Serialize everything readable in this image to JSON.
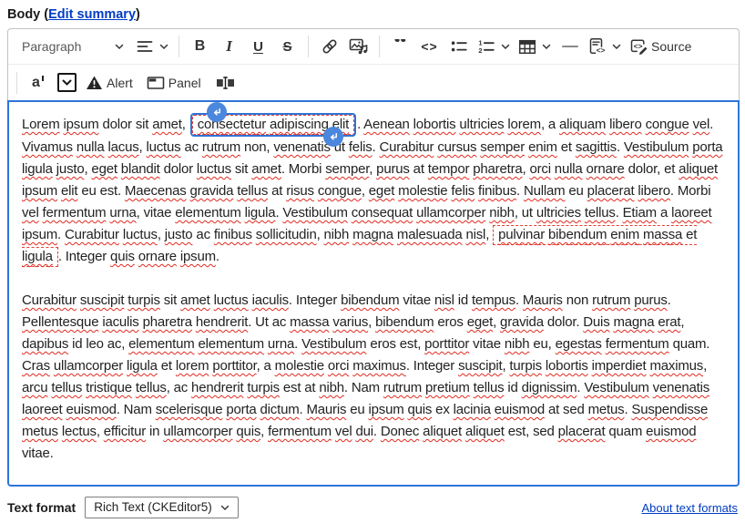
{
  "field": {
    "label_prefix": "Body (",
    "edit_summary_link": "Edit summary",
    "label_suffix": ")"
  },
  "toolbar": {
    "paragraph_label": "Paragraph",
    "bold_label": "B",
    "italic_label": "I",
    "underline_label": "U",
    "strikethrough_label": "S",
    "code_label": "<>",
    "quote_glyph": "“",
    "source_label": "Source",
    "superscript_label": "a",
    "alert_label": "Alert",
    "panel_label": "Panel"
  },
  "editor": {
    "selected_widget_text": "consectetur adipiscing elit",
    "dashed_widget_text": "pulvinar bibendum enim massa et ligula",
    "paragraphs": [
      {
        "segments": [
          {
            "type": "plain",
            "text": "Lorem ipsum dolor sit amet, "
          },
          {
            "type": "widget-selected",
            "text": "consectetur adipiscing elit"
          },
          {
            "type": "plain",
            "text": ". Aenean lobortis ultricies lorem, a aliquam libero congue vel. Vivamus nulla lacus, luctus ac rutrum non, venenatis ut felis. Curabitur cursus semper enim et sagittis. Vestibulum porta ligula justo, eget blandit dolor luctus sit amet. Morbi semper, purus at tempor pharetra, orci nulla ornare dolor, et aliquet ipsum elit eu est. Maecenas gravida tellus at risus congue, eget molestie felis finibus. Nullam eu placerat libero. Morbi vel fermentum urna, vitae elementum ligula. Vestibulum consequat ullamcorper nibh, ut ultricies tellus. Etiam a laoreet ipsum. Curabitur luctus, justo ac finibus sollicitudin, nibh magna malesuada nisl, "
          },
          {
            "type": "widget-dashed",
            "text": "pulvinar bibendum enim massa et ligula"
          },
          {
            "type": "plain",
            "text": ". Integer quis ornare ipsum."
          }
        ]
      },
      {
        "segments": [
          {
            "type": "plain",
            "text": "Curabitur suscipit turpis sit amet luctus iaculis. Integer bibendum vitae nisl id tempus. Mauris non rutrum purus. Pellentesque iaculis pharetra hendrerit. Ut ac massa varius, bibendum eros eget, gravida dolor. Duis magna erat, dapibus id leo ac, elementum elementum urna. Vestibulum eros est, porttitor vitae nibh eu, egestas fermentum quam. Cras ullamcorper ligula et lorem porttitor, a molestie orci maximus. Integer suscipit, turpis lobortis imperdiet maximus, arcu tellus tristique tellus, ac hendrerit turpis est at nibh. Nam rutrum pretium tellus id dignissim. Vestibulum venenatis laoreet euismod. Nam scelerisque porta dictum. Mauris eu ipsum quis ex lacinia euismod at sed metus. Suspendisse metus lectus, efficitur in ullamcorper quis, fermentum vel dui. Donec aliquet aliquet est, sed placerat quam euismod vitae."
          }
        ]
      }
    ],
    "spellcheck_clean_words": [
      "a",
      "ac",
      "at",
      "dolor",
      "eros",
      "est",
      "et",
      "eu",
      "ex",
      "id",
      "in",
      "integer",
      "leo",
      "morbi",
      "nam",
      "non",
      "quam",
      "sed",
      "sit",
      "ut",
      "vitae"
    ]
  },
  "footer": {
    "label": "Text format",
    "format_value": "Rich Text (CKEditor5)",
    "about_link": "About text formats"
  },
  "colors": {
    "focus_border": "#2e74d9",
    "link": "#003cc5",
    "squiggle": "#e02b20",
    "widget_dash": "#e34033",
    "handle": "#4b87dd",
    "toolbar_border": "#c2c2c2",
    "icon": "#333333"
  }
}
